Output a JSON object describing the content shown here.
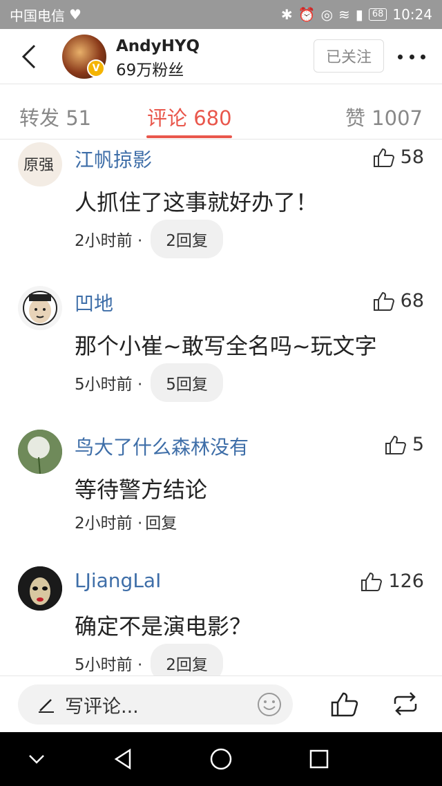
{
  "status_bar": {
    "carrier": "中国电信",
    "battery": "68",
    "time": "10:24"
  },
  "header": {
    "username": "AndyHYQ",
    "fans": "69万粉丝",
    "follow_label": "已关注"
  },
  "tabs": {
    "repost": "转发 51",
    "comments": "评论 680",
    "likes": "赞 1007"
  },
  "comments": [
    {
      "name": "江帆掠影",
      "likes": "58",
      "text": "人抓住了这事就好办了！",
      "time": "2小时前 ·",
      "reply": "2回复"
    },
    {
      "name": "凹地",
      "likes": "68",
      "text": "那个小崔~敢写全名吗~玩文字",
      "time": "5小时前 ·",
      "reply": "5回复"
    },
    {
      "name": "鸟大了什么森林没有",
      "likes": "5",
      "text": "等待警方结论",
      "time": "2小时前 ·",
      "reply": "回复"
    },
    {
      "name": "LJiangLaI",
      "likes": "126",
      "text": "确定不是演电影？",
      "time": "5小时前 ·",
      "reply": "2回复"
    }
  ],
  "bottom_bar": {
    "placeholder": "写评论..."
  },
  "colors": {
    "accent": "#e9574c",
    "link": "#3e6ea8",
    "status_bar": "#999999"
  }
}
